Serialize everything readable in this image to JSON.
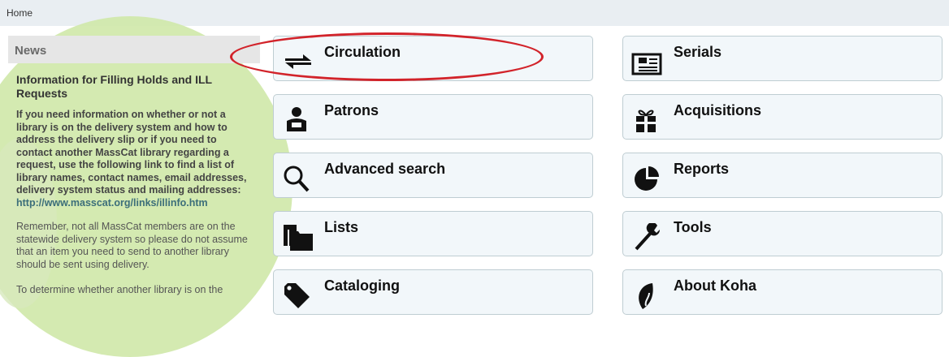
{
  "breadcrumb": {
    "home": "Home"
  },
  "news": {
    "header": "News",
    "title": "Information for Filling Holds and ILL Requests",
    "para1_text": "If you need information on whether or not a library is on the delivery system and how to address the delivery slip or if you need to contact another MassCat library regarding a request, use the following link to find a list of library names, contact names, email addresses, delivery system status and mailing addresses: ",
    "para1_link": "http://www.masscat.org/links/illinfo.htm",
    "para2": "Remember, not all MassCat members are on the statewide delivery system so please do not assume that an item you need to send to another library should be sent using delivery.",
    "para3": "To determine whether another library is on the"
  },
  "modules": {
    "left": [
      {
        "label": "Circulation",
        "icon": "arrows-exchange-icon"
      },
      {
        "label": "Patrons",
        "icon": "user-icon"
      },
      {
        "label": "Advanced search",
        "icon": "search-icon"
      },
      {
        "label": "Lists",
        "icon": "folders-icon"
      },
      {
        "label": "Cataloging",
        "icon": "tag-icon"
      }
    ],
    "right": [
      {
        "label": "Serials",
        "icon": "newspaper-icon"
      },
      {
        "label": "Acquisitions",
        "icon": "gift-icon"
      },
      {
        "label": "Reports",
        "icon": "pie-chart-icon"
      },
      {
        "label": "Tools",
        "icon": "wrench-icon"
      },
      {
        "label": "About Koha",
        "icon": "koha-leaf-icon"
      }
    ]
  },
  "annotation": {
    "color": "#d2232a",
    "target": "Circulation"
  }
}
